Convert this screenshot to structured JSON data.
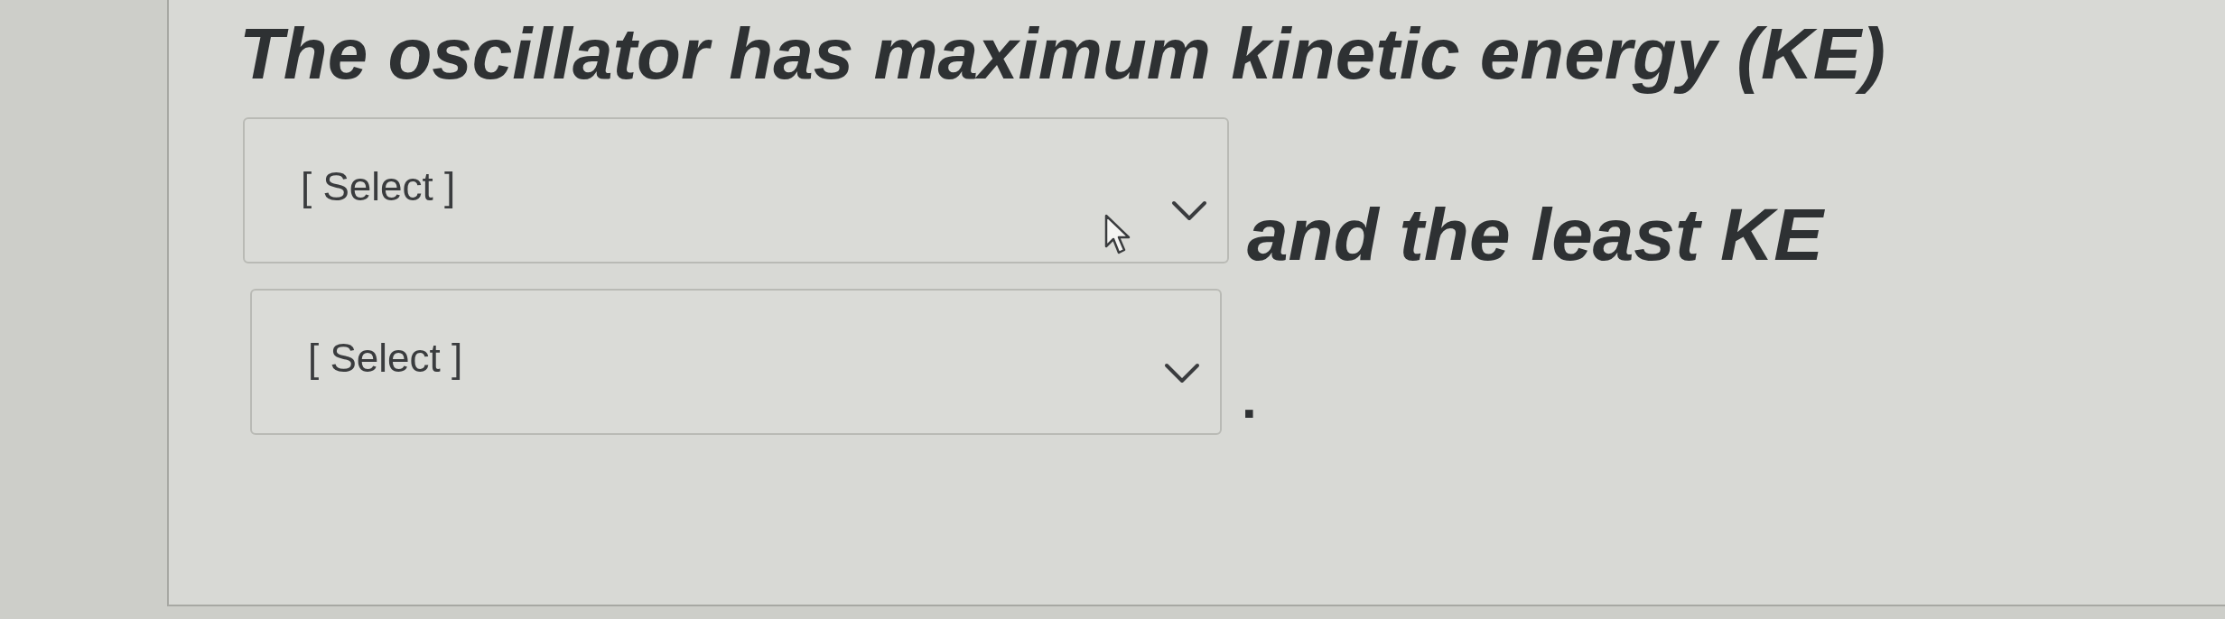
{
  "question": {
    "prompt": "The oscillator has maximum kinetic energy (KE)",
    "dropdowns": [
      {
        "placeholder": "[ Select ]"
      },
      {
        "placeholder": "[ Select ]"
      }
    ],
    "connector": "and the least KE",
    "ending": "."
  }
}
